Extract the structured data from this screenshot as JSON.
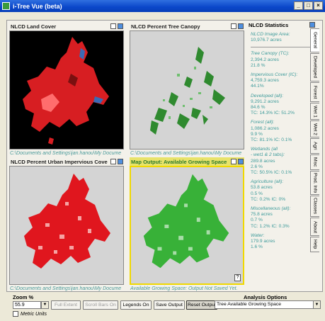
{
  "window": {
    "title": "i-Tree Vue (beta)",
    "controls": [
      "_",
      "□",
      "×"
    ]
  },
  "panels": [
    {
      "title": "NLCD Land Cover",
      "caption": "C:\\Documents and Settings\\jan.hanou\\My Docume",
      "map_colors": {
        "background": "#000000",
        "fill": "#d71e22",
        "accent": "#3b6bb5"
      }
    },
    {
      "title": "NLCD Percent Tree Canopy",
      "caption": "C:\\Documents and Settings\\jan.hanou\\My Docume",
      "map_colors": {
        "background": "#d4d4d4",
        "fill": "#2f8a2f"
      }
    },
    {
      "title": "NLCD Percent Urban Impervious Cove",
      "caption": "C:\\Documents and Settings\\jan.hanou\\My Docume",
      "map_colors": {
        "background": "#d4d4d4",
        "fill": "#e0161e"
      }
    },
    {
      "title": "Map Output: Available Growing Space",
      "caption": "Available Growing Space: Output Not Saved Yet.",
      "map_colors": {
        "background": "#d4d4d4",
        "fill": "#38b138"
      }
    }
  ],
  "stats": {
    "title": "NLCD Statistics",
    "items": [
      {
        "label": "NLCD Image Area:",
        "lines": [
          "10,976.7 acres"
        ]
      },
      {
        "label": "Tree Canopy (TC):",
        "lines": [
          "2,394.2 acres",
          "21.8 %"
        ]
      },
      {
        "label": "Impervious Cover (IC):",
        "lines": [
          "4,759.3 acres",
          "44.1%"
        ]
      },
      {
        "label": "Developed (all):",
        "lines": [
          "9,291.2 acres",
          "84.6 %",
          "   TC: 14.3%   IC: 51.2%"
        ]
      },
      {
        "label": "Forest (all):",
        "lines": [
          "1,086.2 acres",
          "9.9 %",
          "   TC: 81.1%   IC: 0.1%"
        ]
      },
      {
        "label": "Wetlands (all",
        "lines": [
          " - wet1 & 2 tabs):",
          "289.8 acres",
          "2.6 %",
          "   TC: 50.5%   IC: 0.1%"
        ]
      },
      {
        "label": "Agriculture (all):",
        "lines": [
          "53.8 acres",
          "0.5 %",
          "   TC: 0.2%   IC: 0%"
        ]
      },
      {
        "label": "Miscellaneous (all):",
        "lines": [
          "75.8 acres",
          "0.7 %",
          "   TC: 1.2%   IC: 0.3%"
        ]
      },
      {
        "label": "Water:",
        "lines": [
          "179.9 acres",
          "1.6 %"
        ]
      }
    ]
  },
  "tabs": [
    "General",
    "Developed",
    "Forest",
    "Wet 1",
    "Wet 2",
    "Agri",
    "Misc",
    "Prod. Info",
    "Classes",
    "About",
    "Help"
  ],
  "zoom": {
    "label": "Zoom %",
    "value": "55.9"
  },
  "buttons": [
    "Full Extent",
    "Scroll Bars On",
    "Legends On",
    "Save Output",
    "Reset Output"
  ],
  "metric_units": "Metric Units",
  "analysis": {
    "label": "Analysis Options",
    "value": "Tree Available Growing Space"
  }
}
